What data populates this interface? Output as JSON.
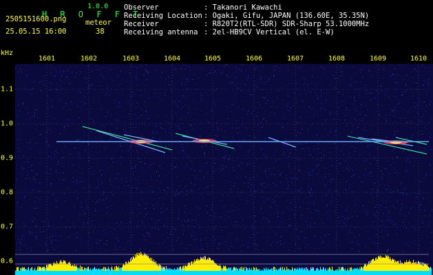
{
  "app": {
    "name": "H R O F F T",
    "version": "1.0.0"
  },
  "file": {
    "name": "2505151600.png",
    "timestamp": "25.05.15 16:00"
  },
  "meteor": {
    "label": "meteor",
    "count": "38"
  },
  "info": [
    {
      "label": "Observer",
      "value": ": Takanori Kawachi"
    },
    {
      "label": "Receiving Location",
      "value": ": Ogaki, Gifu, JAPAN (136.60E, 35.35N)"
    },
    {
      "label": "Receiver",
      "value": ": R820T2(RTL-SDR) SDR-Sharp 53.1000MHz"
    },
    {
      "label": "Receiving antenna",
      "value": ": 2el-HB9CV Vertical (el. E-W)"
    }
  ],
  "axis": {
    "unit": "kHz",
    "x_ticks": [
      "1601",
      "1602",
      "1603",
      "1604",
      "1605",
      "1606",
      "1607",
      "1608",
      "1609",
      "1610"
    ],
    "y_ticks": [
      "1.1",
      "1.0",
      "0.9",
      "0.8",
      "0.7",
      "0.6"
    ]
  },
  "colors": {
    "background": "#000000",
    "spectrum_bg": "#0a0a3c",
    "header_green": "#33ff33",
    "header_yellow": "#ffff33",
    "carrier": "#66aaff",
    "echo": "#ff4466",
    "level_yellow": "#ffee00",
    "level_cyan": "#00ddff"
  }
}
